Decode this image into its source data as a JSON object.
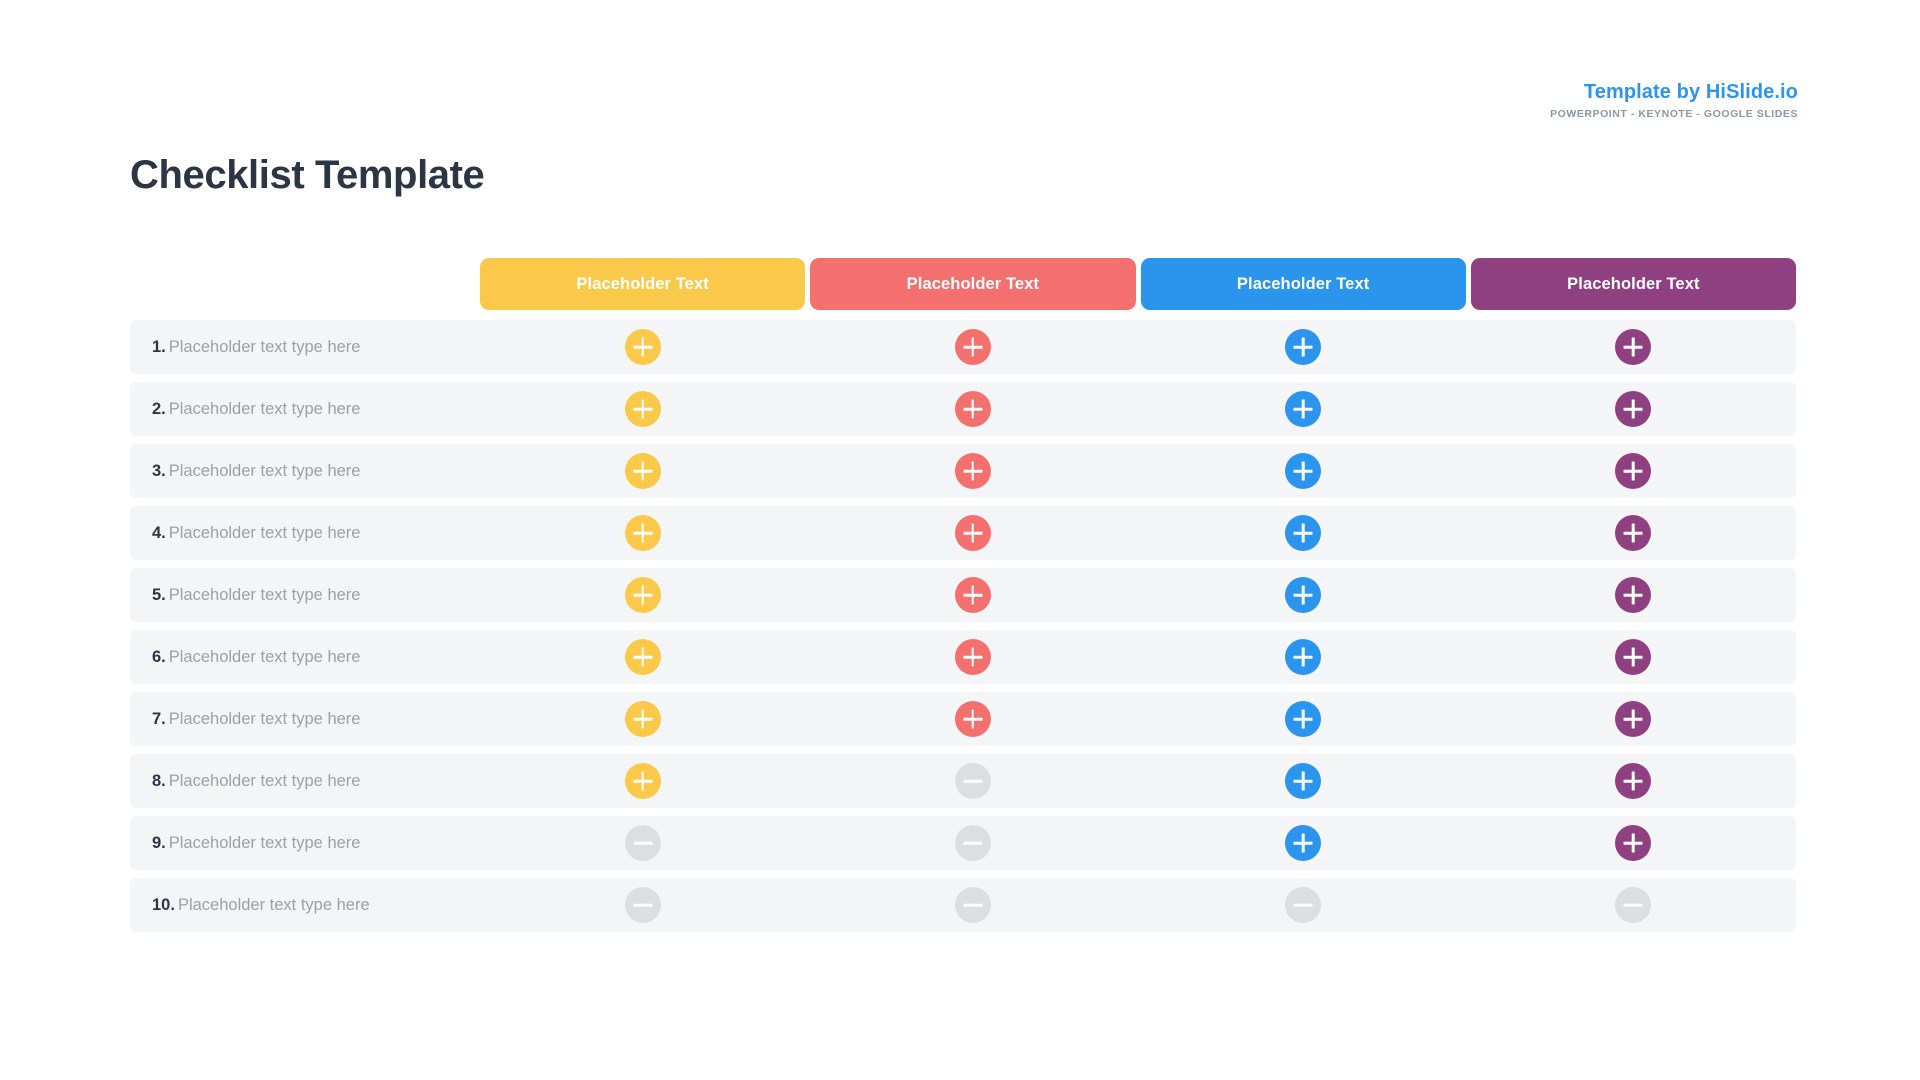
{
  "branding": {
    "prefix": "Template by ",
    "name": "HiSlide.io",
    "subtitle": "POWERPOINT - KEYNOTE - GOOGLE SLIDES",
    "color": "#2b95ee"
  },
  "title": "Checklist Template",
  "colors": {
    "yellow": "#fbc94a",
    "coral": "#f4706e",
    "blue": "#2b95ee",
    "purple": "#8e4080",
    "disabled": "#dcdee1",
    "row_background": "#f4f5f7",
    "title": "#2c3543",
    "label_text": "#9aa0a8"
  },
  "columns": [
    {
      "label": "Placeholder Text",
      "color": "#fbc94a",
      "name": "column-1-yellow"
    },
    {
      "label": "Placeholder Text",
      "color": "#f4706e",
      "name": "column-2-coral"
    },
    {
      "label": "Placeholder Text",
      "color": "#2b95ee",
      "name": "column-3-blue"
    },
    {
      "label": "Placeholder Text",
      "color": "#8e4080",
      "name": "column-4-purple"
    }
  ],
  "icons": {
    "enabled": "plus-icon",
    "disabled": "minus-icon"
  },
  "rows": [
    {
      "number": "1.",
      "label": "Placeholder text type here",
      "states": [
        "plus",
        "plus",
        "plus",
        "plus"
      ]
    },
    {
      "number": "2.",
      "label": "Placeholder text type here",
      "states": [
        "plus",
        "plus",
        "plus",
        "plus"
      ]
    },
    {
      "number": "3.",
      "label": "Placeholder text type here",
      "states": [
        "plus",
        "plus",
        "plus",
        "plus"
      ]
    },
    {
      "number": "4.",
      "label": "Placeholder text type here",
      "states": [
        "plus",
        "plus",
        "plus",
        "plus"
      ]
    },
    {
      "number": "5.",
      "label": "Placeholder text type here",
      "states": [
        "plus",
        "plus",
        "plus",
        "plus"
      ]
    },
    {
      "number": "6.",
      "label": "Placeholder text type here",
      "states": [
        "plus",
        "plus",
        "plus",
        "plus"
      ]
    },
    {
      "number": "7.",
      "label": "Placeholder text type here",
      "states": [
        "plus",
        "plus",
        "plus",
        "plus"
      ]
    },
    {
      "number": "8.",
      "label": "Placeholder text type here",
      "states": [
        "plus",
        "minus",
        "plus",
        "plus"
      ]
    },
    {
      "number": "9.",
      "label": "Placeholder text type here",
      "states": [
        "minus",
        "minus",
        "plus",
        "plus"
      ]
    },
    {
      "number": "10.",
      "label": "Placeholder text type here",
      "states": [
        "minus",
        "minus",
        "minus",
        "minus"
      ]
    }
  ]
}
